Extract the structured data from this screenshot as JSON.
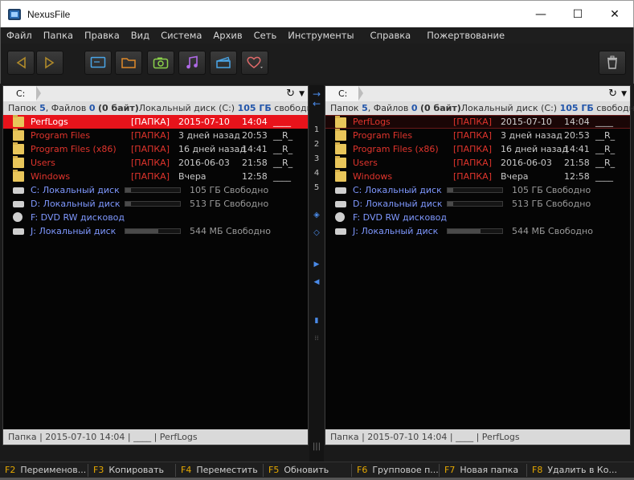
{
  "window": {
    "title": "NexusFile",
    "minimize": "—",
    "maximize": "☐",
    "close": "✕"
  },
  "menu": [
    "Файл",
    "Папка",
    "Правка",
    "Вид",
    "Система",
    "Архив",
    "Сеть",
    "Инструменты",
    "Справка",
    "Пожертвование"
  ],
  "toolbar": {
    "buttons": [
      "back-icon",
      "forward-icon",
      "monitor-icon",
      "folder-icon",
      "camera-icon",
      "music-icon",
      "video-icon",
      "heart-icon",
      "trash-icon"
    ]
  },
  "left": {
    "path": "C:",
    "info": {
      "folders_label": "Папок",
      "folders": "5",
      "files_label": ", Файлов",
      "files": "0",
      "bytes": "(0 байт)",
      "disk_label": "Локальный диск (C:)",
      "free": "105 ГБ",
      "free_label": "свободно"
    },
    "rows": [
      {
        "name": "PerfLogs",
        "type": "[ПАПКА]",
        "date": "2015-07-10",
        "time": "14:04",
        "attr": "____"
      },
      {
        "name": "Program Files",
        "type": "[ПАПКА]",
        "date": "3 дней назад",
        "time": "20:53",
        "attr": "__R_"
      },
      {
        "name": "Program Files (x86)",
        "type": "[ПАПКА]",
        "date": "16 дней назад",
        "time": "14:41",
        "attr": "__R_"
      },
      {
        "name": "Users",
        "type": "[ПАПКА]",
        "date": "2016-06-03",
        "time": "21:58",
        "attr": "__R_"
      },
      {
        "name": "Windows",
        "type": "[ПАПКА]",
        "date": "Вчера",
        "time": "12:58",
        "attr": "____"
      }
    ],
    "drives": [
      {
        "name": "C: Локальный диск",
        "free": "105 ГБ Свободно",
        "used": 0.1,
        "icon": "drive-icon"
      },
      {
        "name": "D: Локальный диск",
        "free": "513 ГБ Свободно",
        "used": 0.1,
        "icon": "drive-icon"
      },
      {
        "name": "F:  DVD RW дисковод",
        "free": "",
        "used": 0,
        "icon": "dvd-icon"
      },
      {
        "name": "J:  Локальный диск",
        "free": "544 МБ Свободно",
        "used": 0.6,
        "icon": "drive-icon"
      }
    ],
    "status": "Папка  |  2015-07-10 14:04  |  ____  |  PerfLogs"
  },
  "right": {
    "path": "C:",
    "info": {
      "folders_label": "Папок",
      "folders": "5",
      "files_label": ", Файлов",
      "files": "0",
      "bytes": "(0 байт)",
      "disk_label": "Локальный диск (C:)",
      "free": "105 ГБ",
      "free_label": "свободно"
    },
    "rows": [
      {
        "name": "PerfLogs",
        "type": "[ПАПКА]",
        "date": "2015-07-10",
        "time": "14:04",
        "attr": "____"
      },
      {
        "name": "Program Files",
        "type": "[ПАПКА]",
        "date": "3 дней назад",
        "time": "20:53",
        "attr": "__R_"
      },
      {
        "name": "Program Files (x86)",
        "type": "[ПАПКА]",
        "date": "16 дней назад",
        "time": "14:41",
        "attr": "__R_"
      },
      {
        "name": "Users",
        "type": "[ПАПКА]",
        "date": "2016-06-03",
        "time": "21:58",
        "attr": "__R_"
      },
      {
        "name": "Windows",
        "type": "[ПАПКА]",
        "date": "Вчера",
        "time": "12:58",
        "attr": "____"
      }
    ],
    "drives": [
      {
        "name": "C: Локальный диск",
        "free": "105 ГБ Свободно",
        "used": 0.1,
        "icon": "drive-icon"
      },
      {
        "name": "D: Локальный диск",
        "free": "513 ГБ Свободно",
        "used": 0.1,
        "icon": "drive-icon"
      },
      {
        "name": "F:  DVD RW дисковод",
        "free": "",
        "used": 0,
        "icon": "dvd-icon"
      },
      {
        "name": "J:  Локальный диск",
        "free": "544 МБ Свободно",
        "used": 0.6,
        "icon": "drive-icon"
      }
    ],
    "status": "Папка  |  2015-07-10 14:04  |  ____  |  PerfLogs"
  },
  "center": {
    "tabs": [
      "1",
      "2",
      "3",
      "4",
      "5"
    ]
  },
  "fkeys": [
    {
      "key": "F2",
      "label": "Переименов..."
    },
    {
      "key": "F3",
      "label": "Копировать"
    },
    {
      "key": "F4",
      "label": "Переместить"
    },
    {
      "key": "F5",
      "label": "Обновить"
    },
    {
      "key": "F6",
      "label": "Групповое п..."
    },
    {
      "key": "F7",
      "label": "Новая папка"
    },
    {
      "key": "F8",
      "label": "Удалить в Ко..."
    }
  ],
  "colors": {
    "accent_red": "#e8131b",
    "folder_text": "#e0342c",
    "drive_text": "#7f98ff",
    "fkey": "#e5a800"
  }
}
